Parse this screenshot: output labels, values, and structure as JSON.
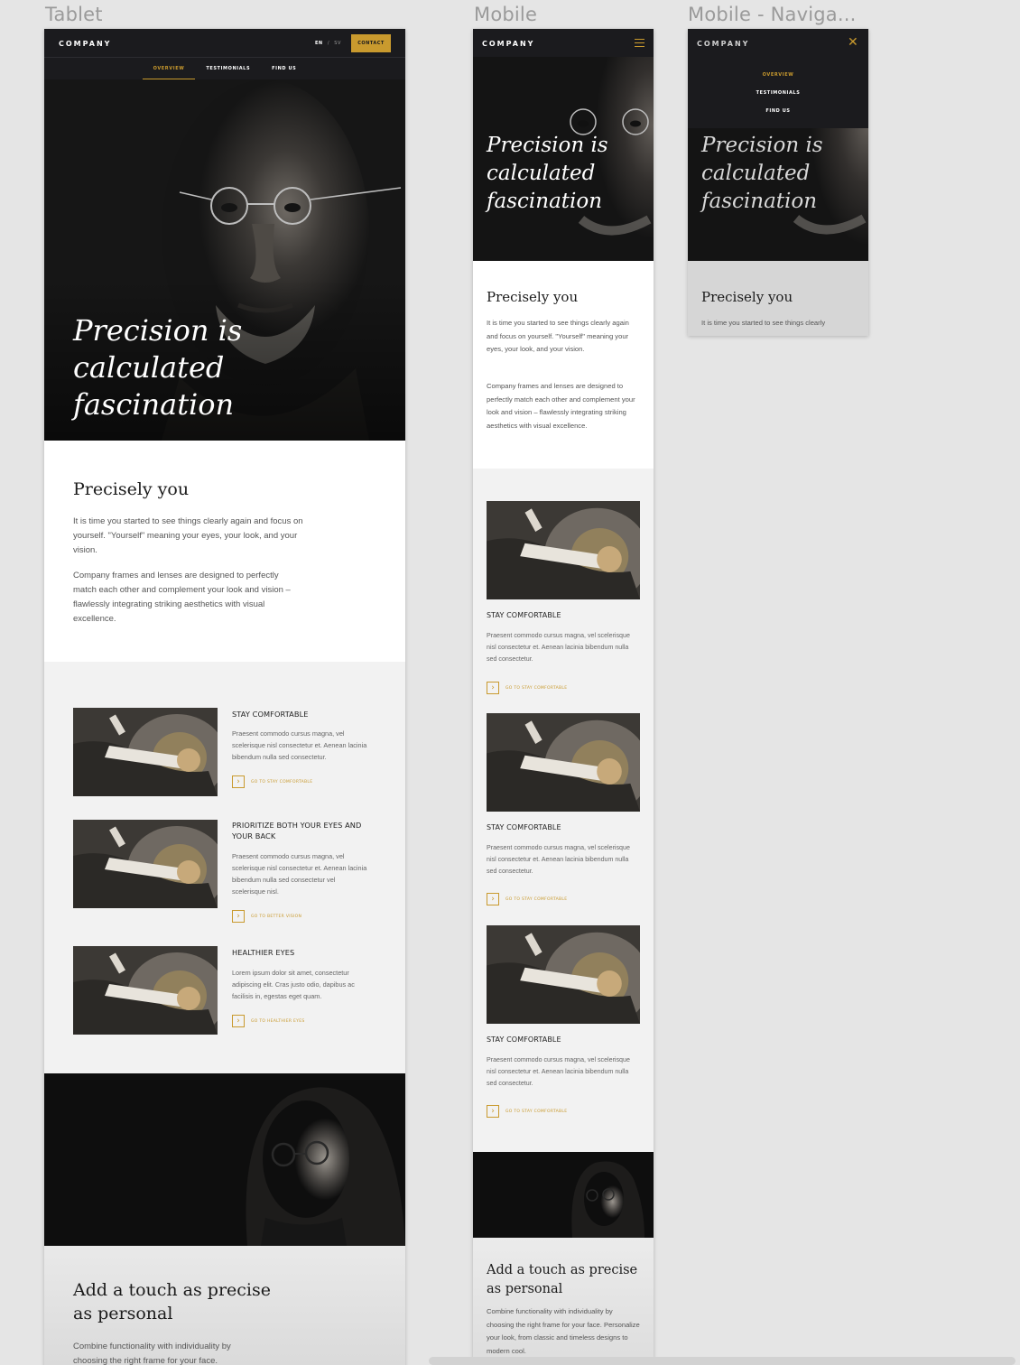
{
  "frames": {
    "tablet": "Tablet",
    "mobile": "Mobile",
    "mobile_nav": "Mobile - Naviga..."
  },
  "brand": "COMPANY",
  "lang": {
    "active": "EN",
    "separator": "/",
    "other": "SV"
  },
  "contact_label": "CONTACT",
  "nav": [
    "OVERVIEW",
    "TESTIMONIALS",
    "FIND US"
  ],
  "hero": {
    "title": "Precision is calculated fascination",
    "title_lines": [
      "Precision is",
      "calculated",
      "fascination"
    ]
  },
  "intro": {
    "title": "Precisely you",
    "p1": "It is time you started to see things clearly again and focus on yourself. \"Yourself\" meaning your eyes, your look, and your vision.",
    "p2": "Company frames and lenses are designed to perfectly match each other and complement your look and vision – flawlessly integrating striking aesthetics with visual excellence.",
    "p1_cut": "It is time you started to see things clearly"
  },
  "features": [
    {
      "title": "STAY COMFORTABLE",
      "text": "Praesent commodo cursus magna, vel scelerisque nisl consectetur et. Aenean lacinia bibendum nulla sed consectetur.",
      "link": "GO TO STAY COMFORTABLE"
    },
    {
      "title": "PRIORITIZE BOTH YOUR EYES AND YOUR BACK",
      "text": "Praesent commodo cursus magna, vel scelerisque nisl consectetur et. Aenean lacinia bibendum nulla sed consectetur vel scelerisque nisl.",
      "link": "GO TO BETTER VISION"
    },
    {
      "title": "HEALTHIER EYES",
      "text": "Lorem ipsum dolor sit amet, consectetur adipiscing elit. Cras justo odio, dapibus ac facilisis in, egestas eget quam.",
      "link": "GO TO HEALTHIER EYES"
    }
  ],
  "personal": {
    "title": "Add a touch as precise as personal",
    "text_tablet": "Combine functionality with individuality by choosing the right frame for your face.",
    "text_mobile": "Combine functionality with individuality by choosing the right frame for your face. Personalize your look, from classic and timeless designs to modern cool."
  },
  "colors": {
    "accent": "#c99a2e",
    "dark": "#1b1b1e",
    "grey_section": "#f2f2f2"
  },
  "icons": {
    "menu": "hamburger-icon",
    "close": "close-icon",
    "arrow": "chevron-right-icon"
  }
}
